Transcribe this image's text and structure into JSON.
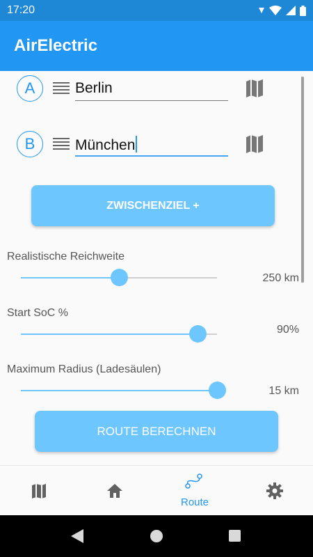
{
  "status_bar": {
    "time": "17:20"
  },
  "app_bar": {
    "title": "AirElectric"
  },
  "waypoints": [
    {
      "badge": "A",
      "value": "Berlin"
    },
    {
      "badge": "B",
      "value": "München"
    }
  ],
  "add_stop_button": "ZWISCHENZIEL +",
  "sliders": [
    {
      "label": "Realistische Reichweite",
      "value_text": "250 km",
      "fraction": 0.5
    },
    {
      "label": "Start SoC %",
      "value_text": "90%",
      "fraction": 0.9
    },
    {
      "label": "Maximum Radius (Ladesäulen)",
      "value_text": "15 km",
      "fraction": 1.0
    }
  ],
  "calculate_button": "ROUTE BERECHNEN",
  "bottom_nav": [
    {
      "icon": "map-icon",
      "label": ""
    },
    {
      "icon": "home-icon",
      "label": ""
    },
    {
      "icon": "route-icon",
      "label": "Route",
      "active": true
    },
    {
      "icon": "gear-icon",
      "label": ""
    }
  ],
  "colors": {
    "primary": "#2196f3",
    "accent": "#6ec6ff",
    "status_bar": "#1e88d6"
  }
}
